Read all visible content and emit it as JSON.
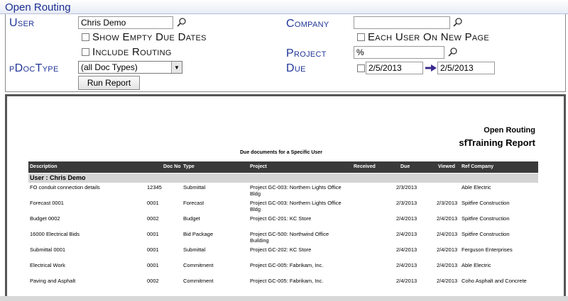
{
  "window": {
    "title": "Open Routing"
  },
  "criteria": {
    "user_label": "User",
    "user_value": "Chris Demo",
    "show_empty_label": "Show Empty Due Dates",
    "include_routing_label": "Include Routing",
    "pdoctype_label": "pDocType",
    "pdoctype_value": "(all Doc Types)",
    "run_report_label": "Run Report",
    "company_label": "Company",
    "company_value": "",
    "each_user_label": "Each User On New Page",
    "project_label": "Project",
    "project_value": "%",
    "due_label": "Due",
    "due_from": "2/5/2013",
    "due_to": "2/5/2013"
  },
  "report": {
    "title": "Open Routing",
    "subtitle": "sfTraining Report",
    "caption": "Due documents for a Specific User",
    "columns": [
      "Description",
      "Doc No",
      "Type",
      "Project",
      "Received",
      "Due",
      "Viewed",
      "Ref Company"
    ],
    "group_label": "User : Chris Demo",
    "rows": [
      {
        "description": "FO conduit connection details",
        "docno": "12345",
        "type": "Submittal",
        "project": "Project GC-003: Northern Lights Office Bldg",
        "received": "",
        "due": "2/3/2013",
        "viewed": "",
        "company": "Able Electric"
      },
      {
        "description": "Forecast 0001",
        "docno": "0001",
        "type": "Forecast",
        "project": "Project GC-003: Northern Lights Office Bldg",
        "received": "",
        "due": "2/3/2013",
        "viewed": "2/3/2013",
        "company": "Spitfire Construction"
      },
      {
        "description": "Budget 0002",
        "docno": "0002",
        "type": "Budget",
        "project": "Project GC-201: KC Store",
        "received": "",
        "due": "2/4/2013",
        "viewed": "2/4/2013",
        "company": "Spitfire Construction"
      },
      {
        "description": "16000 Electrical Bids",
        "docno": "0001",
        "type": "Bid Package",
        "project": "Project GC-500: Northwind Office Building",
        "received": "",
        "due": "2/4/2013",
        "viewed": "2/4/2013",
        "company": "Spitfire Construction"
      },
      {
        "description": "Submittal 0001",
        "docno": "0001",
        "type": "Submittal",
        "project": "Project GC-202: KC Store",
        "received": "",
        "due": "2/4/2013",
        "viewed": "2/4/2013",
        "company": "Ferguson Enterprises"
      },
      {
        "description": "Electrical Work",
        "docno": "0001",
        "type": "Commitment",
        "project": "Project GC-005: Fabrikam, Inc.",
        "received": "",
        "due": "2/4/2013",
        "viewed": "2/4/2013",
        "company": "Able Electric"
      },
      {
        "description": "Paving and Asphalt",
        "docno": "0002",
        "type": "Commitment",
        "project": "Project GC-005: Fabrikam, Inc.",
        "received": "",
        "due": "2/4/2013",
        "viewed": "2/4/2013",
        "company": "Coho Asphalt and Concrete"
      }
    ]
  },
  "icons": {
    "lookup": "magnifier-icon",
    "range_arrow": "arrow-right-icon",
    "dropdown": "chevron-down-icon"
  },
  "colors": {
    "label": "#1f3597",
    "header_bg": "#3a3a3a",
    "group_bg": "#d4d4d4",
    "arrow": "#3a2a8f"
  }
}
